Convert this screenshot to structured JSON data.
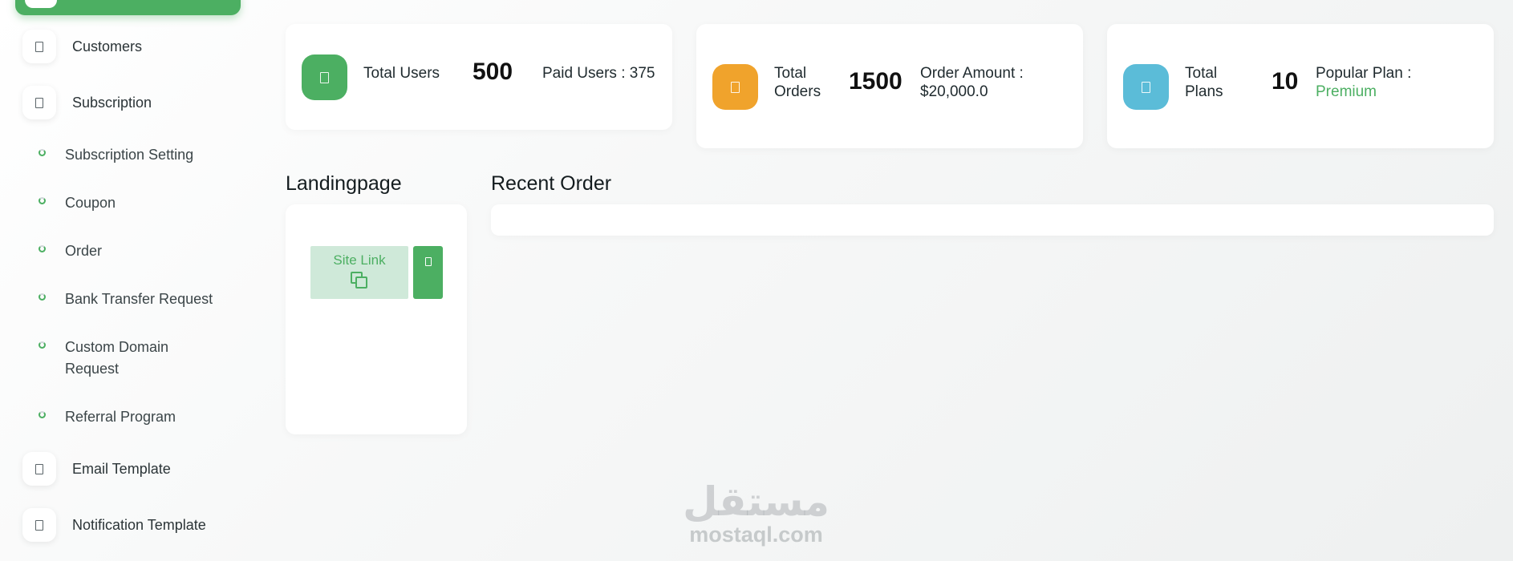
{
  "sidebar": {
    "main_items": [
      {
        "label": "Customers",
        "icon": "document-icon"
      },
      {
        "label": "Subscription",
        "icon": "document-icon"
      },
      {
        "label": "Email Template",
        "icon": "document-icon"
      },
      {
        "label": "Notification Template",
        "icon": "document-icon"
      }
    ],
    "sub_items": [
      {
        "label": "Subscription Setting"
      },
      {
        "label": "Coupon"
      },
      {
        "label": "Order"
      },
      {
        "label": "Bank Transfer Request"
      },
      {
        "label": "Custom Domain Request"
      },
      {
        "label": "Referral Program"
      }
    ]
  },
  "stats": [
    {
      "title": "Total Users",
      "value": "500",
      "extra": "Paid Users : 375",
      "color": "#4caf62"
    },
    {
      "title": "Total Orders",
      "value": "1500",
      "extra_label": "Order Amount :",
      "extra_value": "$20,000.0",
      "color": "#f0a32c"
    },
    {
      "title": "Total Plans",
      "value": "10",
      "extra_label": "Popular Plan :",
      "extra_value": "Premium",
      "color": "#5bbcd8"
    }
  ],
  "landing": {
    "title": "Landingpage",
    "site_link_label": "Site Link"
  },
  "recent_order": {
    "title": "Recent Order"
  },
  "watermark": {
    "logo_text": "مستقل",
    "url": "mostaql.com"
  },
  "colors": {
    "accent": "#4caf62",
    "orange": "#f0a32c",
    "blue": "#5bbcd8"
  }
}
